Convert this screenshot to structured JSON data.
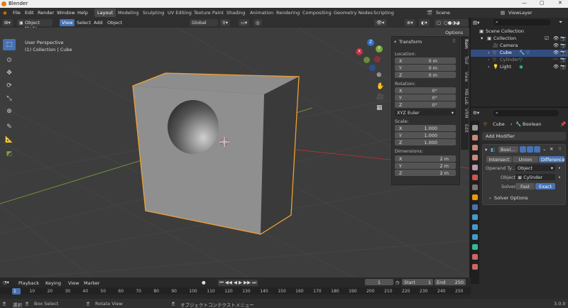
{
  "window": {
    "title": "Blender",
    "controls": [
      "—",
      "▢",
      "✕"
    ]
  },
  "menu": [
    "File",
    "Edit",
    "Render",
    "Window",
    "Help"
  ],
  "workspaces": [
    "Layout",
    "Modeling",
    "Sculpting",
    "UV Editing",
    "Texture Paint",
    "Shading",
    "Animation",
    "Rendering",
    "Compositing",
    "Geometry Nodes",
    "Scripting"
  ],
  "active_workspace": "Layout",
  "scene": "Scene",
  "view_layer": "ViewLayer",
  "header3d": {
    "mode": "Object Mode",
    "menus": [
      "View",
      "Select",
      "Add",
      "Object"
    ],
    "orientation": "Global",
    "options": "Options"
  },
  "viewport": {
    "overlay_line1": "User Perspective",
    "overlay_line2": "(1) Collection | Cube"
  },
  "gizmo": {
    "x": "X",
    "y": "Y",
    "z": "Z"
  },
  "npanel": {
    "title": "Transform",
    "location_label": "Location:",
    "rotation_label": "Rotation:",
    "mode": "XYZ Euler",
    "scale_label": "Scale:",
    "dimensions_label": "Dimensions:",
    "location": [
      [
        "X",
        "0 m"
      ],
      [
        "Y",
        "0 m"
      ],
      [
        "Z",
        "0 m"
      ]
    ],
    "rotation": [
      [
        "X",
        "0°"
      ],
      [
        "Y",
        "0°"
      ],
      [
        "Z",
        "0°"
      ]
    ],
    "scale": [
      [
        "X",
        "1.000"
      ],
      [
        "Y",
        "1.000"
      ],
      [
        "Z",
        "1.000"
      ]
    ],
    "dimensions": [
      [
        "X",
        "2 m"
      ],
      [
        "Y",
        "2 m"
      ],
      [
        "Z",
        "2 m"
      ]
    ]
  },
  "ntabs": [
    "Item",
    "Tool",
    "View",
    "MB-Lab",
    "VRM",
    "Edit"
  ],
  "outliner": {
    "root": "Scene Collection",
    "collection": "Collection",
    "items": [
      "Camera",
      "Cube",
      "Cylinder",
      "Light"
    ],
    "selected": "Cube"
  },
  "properties": {
    "object": "Cube",
    "modifier_type": "Boolean",
    "add_modifier": "Add Modifier",
    "modifier_name": "Bool…",
    "ops": [
      "Intersect",
      "Union",
      "Difference"
    ],
    "active_op": "Difference",
    "operand_type_label": "Operand Ty…",
    "operand_type": "Object",
    "object_label": "Object",
    "object_value": "Cylinder",
    "solver_label": "Solver",
    "solver_opts": [
      "Fast",
      "Exact"
    ],
    "active_solver": "Exact",
    "solver_options": "Solver Options"
  },
  "timeline": {
    "menus": [
      "Playback",
      "Keying",
      "View",
      "Marker"
    ],
    "current": "1",
    "start_label": "Start",
    "start": "1",
    "end_label": "End",
    "end": "250",
    "ticks": [
      "1",
      "10",
      "20",
      "30",
      "40",
      "50",
      "60",
      "70",
      "80",
      "90",
      "100",
      "110",
      "120",
      "130",
      "140",
      "150",
      "160",
      "170",
      "180",
      "190",
      "200",
      "210",
      "220",
      "230",
      "240",
      "250"
    ]
  },
  "status": {
    "select": "選択",
    "box_select": "Box Select",
    "rotate_view": "Rotate View",
    "context_menu": "オブジェクトコンテクストメニュー",
    "version": "3.0.0"
  },
  "colors": {
    "selection_outline": "#f0a030",
    "accent": "#4772b3",
    "x_axis": "#c03040",
    "y_axis": "#7aa83a",
    "z_axis": "#2f72c8"
  }
}
